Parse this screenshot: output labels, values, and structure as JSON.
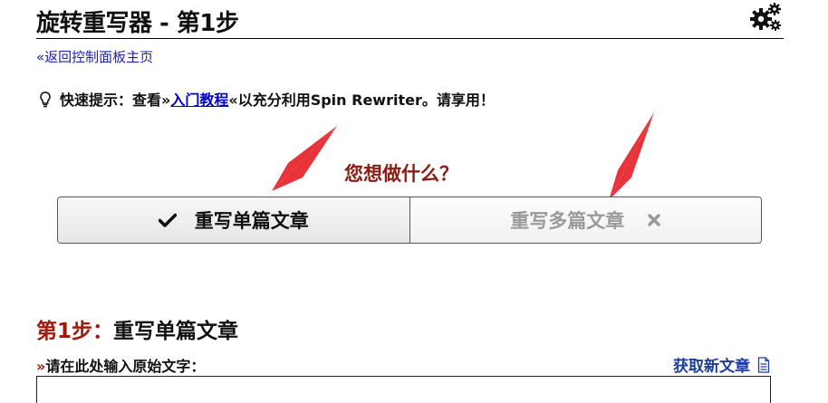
{
  "header": {
    "title": "旋转重写器 - 第1步",
    "settings_icon": "gears-icon"
  },
  "back_link": "«返回控制面板主页",
  "tip": {
    "icon": "lightbulb-icon",
    "prefix": "快速提示：查看»",
    "link_text": "入门教程",
    "suffix": "«以充分利用Spin Rewriter。请享用！"
  },
  "question": "您想做什么？",
  "mode_toggle": {
    "single_label": "重写单篇文章",
    "multiple_label": "重写多篇文章",
    "active": "single"
  },
  "step": {
    "number": "第1步：",
    "title": "重写单篇文章"
  },
  "input": {
    "label_marker": "»",
    "label": "请在此处输入原始文字：",
    "value": ""
  },
  "get_article": {
    "label": "获取新文章",
    "icon": "document-icon"
  },
  "colors": {
    "accent_red": "#a01a0c",
    "question_red": "#8b1c13",
    "link_blue": "#0000cc",
    "annotation_arrow": "#e8333a"
  }
}
